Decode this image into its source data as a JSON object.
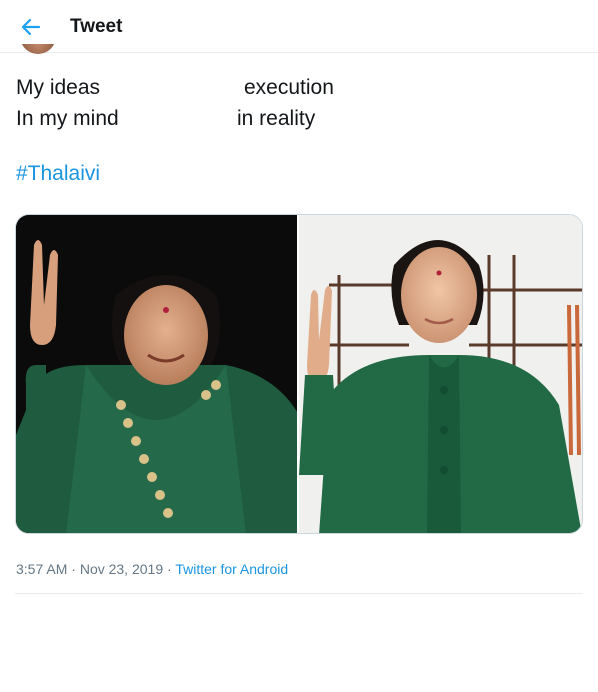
{
  "header": {
    "title": "Tweet",
    "back_icon": "arrow-left-icon",
    "accent": "#1da1f2"
  },
  "tweet": {
    "lines": [
      {
        "left": "My ideas",
        "right": "execution"
      },
      {
        "left": "In my mind",
        "right": "in reality"
      }
    ],
    "hashtag": "#Thalaivi",
    "link_color": "#1b95e0",
    "media": [
      {
        "alt": "Woman in green saree making a victory sign"
      },
      {
        "alt": "Actress in green outfit making a victory sign"
      }
    ],
    "time": "3:57 AM",
    "dot": " · ",
    "date": "Nov 23, 2019",
    "source": "Twitter for Android"
  }
}
